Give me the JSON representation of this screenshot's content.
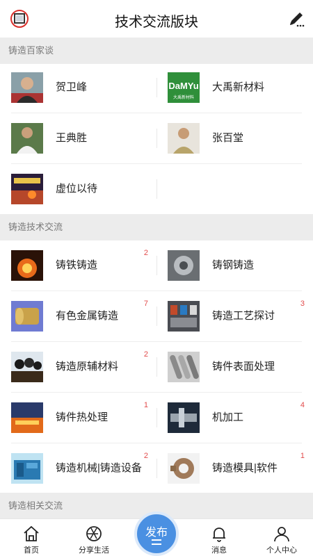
{
  "header": {
    "title": "技术交流版块",
    "left_icon": "chat-square-icon",
    "right_icon": "edit-pencil-icon"
  },
  "sections": {
    "experts": {
      "title": "铸造百家谈"
    },
    "tech": {
      "title": "铸造技术交流"
    },
    "related": {
      "title": "铸造相关交流"
    }
  },
  "experts": [
    {
      "label": "贺卫峰",
      "badge": ""
    },
    {
      "label": "大禹新材料",
      "badge": ""
    },
    {
      "label": "王典胜",
      "badge": ""
    },
    {
      "label": "张百堂",
      "badge": ""
    },
    {
      "label": "虚位以待",
      "badge": ""
    }
  ],
  "tech": [
    {
      "label": "铸铁铸造",
      "badge": "2"
    },
    {
      "label": "铸钢铸造",
      "badge": ""
    },
    {
      "label": "有色金属铸造",
      "badge": "7"
    },
    {
      "label": "铸造工艺探讨",
      "badge": "3"
    },
    {
      "label": "铸造原辅材料",
      "badge": "2"
    },
    {
      "label": "铸件表面处理",
      "badge": ""
    },
    {
      "label": "铸件热处理",
      "badge": "1"
    },
    {
      "label": "机加工",
      "badge": "4"
    },
    {
      "label": "铸造机械|铸造设备",
      "badge": "2"
    },
    {
      "label": "铸造模具|软件",
      "badge": "1"
    }
  ],
  "logo_text": {
    "brand": "DaMYu",
    "sub": "大禹新材料"
  },
  "tabbar": {
    "home": "首页",
    "share": "分享生活",
    "publish": "发布",
    "messages": "消息",
    "profile": "个人中心"
  },
  "colors": {
    "accent": "#4a90e2",
    "badge": "#e24b4b",
    "section_bg": "#ececec"
  }
}
